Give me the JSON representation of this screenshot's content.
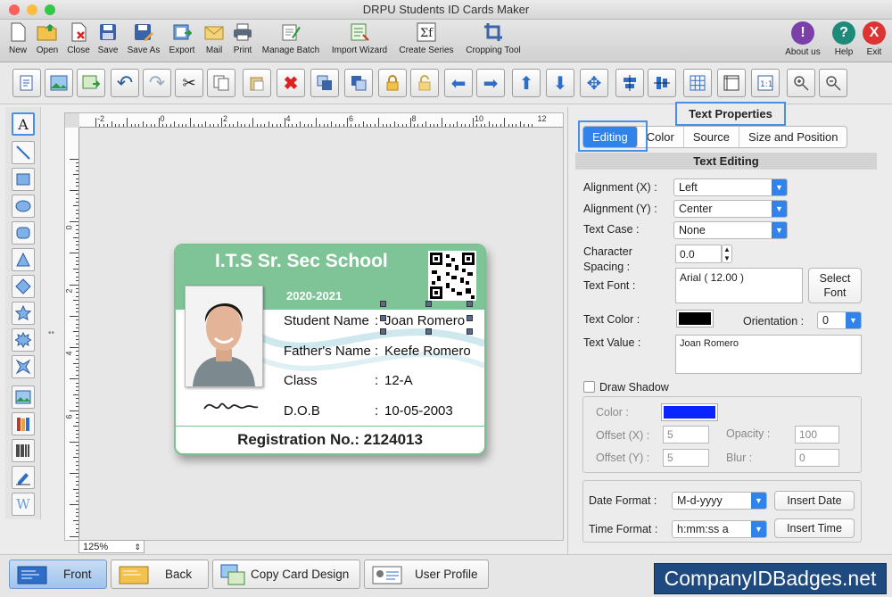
{
  "window": {
    "title": "DRPU Students ID Cards Maker"
  },
  "toolbar": {
    "items": [
      "New",
      "Open",
      "Close",
      "Save",
      "Save As",
      "Export",
      "Mail",
      "Print",
      "Manage Batch",
      "Import Wizard",
      "Create Series",
      "Cropping Tool"
    ],
    "right_items": [
      "About us",
      "Help",
      "Exit"
    ]
  },
  "canvas": {
    "zoom": "125%",
    "ruler_h": [
      "-2",
      "0",
      "2",
      "4",
      "6",
      "8",
      "10",
      "12"
    ],
    "ruler_v": [
      "0",
      "2",
      "4",
      "6"
    ]
  },
  "card": {
    "school": "I.T.S Sr. Sec School",
    "year": "2020-2021",
    "fields": [
      {
        "label": "Student Name",
        "colon": ":",
        "value": "Joan Romero"
      },
      {
        "label": "Father's Name",
        "colon": ":",
        "value": "Keefe Romero"
      },
      {
        "label": "Class",
        "colon": ":",
        "value": "12-A"
      },
      {
        "label": "D.O.B",
        "colon": ":",
        "value": "10-05-2003"
      }
    ],
    "reg_label": "Registration No.:",
    "reg_value": "2124013"
  },
  "panel": {
    "title": "Text Properties",
    "tabs": [
      "Editing",
      "Color",
      "Source",
      "Size and Position"
    ],
    "active_tab": "Editing",
    "section": "Text Editing",
    "alignment_x_label": "Alignment (X) :",
    "alignment_x": "Left",
    "alignment_y_label": "Alignment (Y) :",
    "alignment_y": "Center",
    "text_case_label": "Text Case :",
    "text_case": "None",
    "char_spacing_label1": "Character",
    "char_spacing_label2": "Spacing :",
    "char_spacing": "0.0",
    "text_font_label": "Text Font :",
    "text_font": "Arial ( 12.00 )",
    "select_font_line1": "Select",
    "select_font_line2": "Font",
    "text_color_label": "Text Color :",
    "text_color": "#000000",
    "orientation_label": "Orientation :",
    "orientation": "0",
    "text_value_label": "Text Value :",
    "text_value": "Joan Romero",
    "shadow": {
      "label": "Draw Shadow",
      "checked": false,
      "color_label": "Color :",
      "color": "#0a24ff",
      "offset_x_label": "Offset (X) :",
      "offset_x": "5",
      "offset_y_label": "Offset (Y) :",
      "offset_y": "5",
      "opacity_label": "Opacity :",
      "opacity": "100",
      "blur_label": "Blur :",
      "blur": "0"
    },
    "date_format_label": "Date Format :",
    "date_format": "M-d-yyyy",
    "insert_date": "Insert Date",
    "time_format_label": "Time Format :",
    "time_format": "h:mm:ss a",
    "insert_time": "Insert Time"
  },
  "bottom": {
    "front": "Front",
    "back": "Back",
    "copy": "Copy Card Design",
    "profile": "User Profile"
  },
  "brand": "CompanyIDBadges.net",
  "colors": {
    "accent": "#2f83ea",
    "card_green": "#7ec496",
    "brand_bg": "#1f4a80"
  }
}
